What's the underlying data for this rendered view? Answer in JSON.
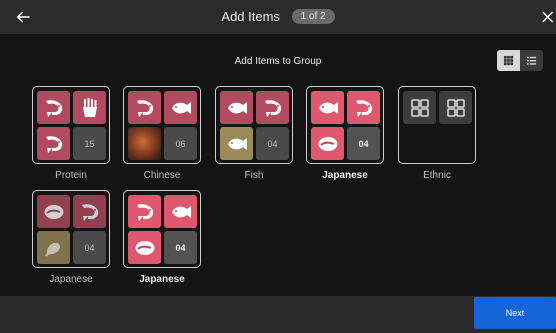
{
  "header": {
    "title": "Add Items",
    "pager": "1 of 2"
  },
  "subtitle": "Add Items to Group",
  "groups": [
    {
      "label": "Protein"
    },
    {
      "label": "Chinese"
    },
    {
      "label": "Fish"
    },
    {
      "label": "Japanese"
    },
    {
      "label": "Ethnic"
    },
    {
      "label": "Japanese"
    },
    {
      "label": "Japanese"
    }
  ],
  "counts": {
    "protein": "15",
    "chinese": "06",
    "fish": "04",
    "japanese1": "04",
    "japanese2": "04",
    "japanese3": "04"
  },
  "footer": {
    "next_label": "Next"
  },
  "colors": {
    "accent": "#1565d8",
    "item_pink": "#b24a60",
    "item_pink_bright": "#e0586f"
  }
}
